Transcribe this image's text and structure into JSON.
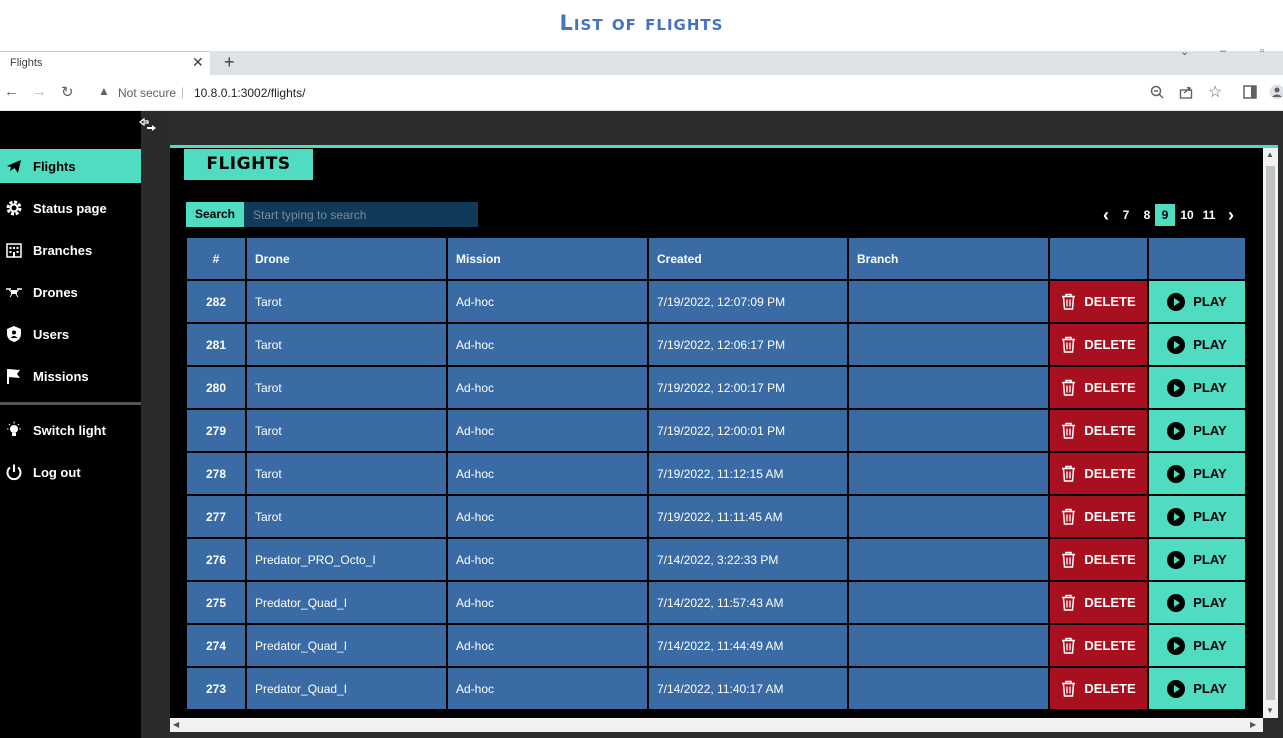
{
  "doc_title": "List of flights",
  "browser": {
    "tab_title": "Flights",
    "tab_close": "✕",
    "new_tab": "+",
    "back_icon": "←",
    "forward_icon": "→",
    "reload_icon": "↻",
    "not_secure": "Not secure",
    "url": "10.8.0.1:3002/flights/"
  },
  "sidebar": {
    "items": [
      {
        "label": "Flights",
        "icon": "plane-icon",
        "active": true
      },
      {
        "label": "Status page",
        "icon": "gear-icon"
      },
      {
        "label": "Branches",
        "icon": "building-icon"
      },
      {
        "label": "Drones",
        "icon": "drone-icon"
      },
      {
        "label": "Users",
        "icon": "shield-icon"
      },
      {
        "label": "Missions",
        "icon": "flag-icon"
      }
    ],
    "bottom_items": [
      {
        "label": "Switch light",
        "icon": "bulb-icon"
      },
      {
        "label": "Log out",
        "icon": "power-icon"
      }
    ]
  },
  "page": {
    "heading": "FLIGHTS",
    "search_label": "Search",
    "search_placeholder": "Start typing to search"
  },
  "pager": {
    "prev": "‹",
    "next": "›",
    "pages": [
      "7",
      "8",
      "9",
      "10",
      "11"
    ],
    "current": "9"
  },
  "table": {
    "headers": [
      "#",
      "Drone",
      "Mission",
      "Created",
      "Branch",
      "",
      ""
    ],
    "delete_label": "DELETE",
    "play_label": "PLAY",
    "rows": [
      {
        "id": "282",
        "drone": "Tarot",
        "mission": "Ad-hoc",
        "created": "7/19/2022, 12:07:09 PM",
        "branch": ""
      },
      {
        "id": "281",
        "drone": "Tarot",
        "mission": "Ad-hoc",
        "created": "7/19/2022, 12:06:17 PM",
        "branch": ""
      },
      {
        "id": "280",
        "drone": "Tarot",
        "mission": "Ad-hoc",
        "created": "7/19/2022, 12:00:17 PM",
        "branch": ""
      },
      {
        "id": "279",
        "drone": "Tarot",
        "mission": "Ad-hoc",
        "created": "7/19/2022, 12:00:01 PM",
        "branch": ""
      },
      {
        "id": "278",
        "drone": "Tarot",
        "mission": "Ad-hoc",
        "created": "7/19/2022, 11:12:15 AM",
        "branch": ""
      },
      {
        "id": "277",
        "drone": "Tarot",
        "mission": "Ad-hoc",
        "created": "7/19/2022, 11:11:45 AM",
        "branch": ""
      },
      {
        "id": "276",
        "drone": "Predator_PRO_Octo_I",
        "mission": "Ad-hoc",
        "created": "7/14/2022, 3:22:33 PM",
        "branch": ""
      },
      {
        "id": "275",
        "drone": "Predator_Quad_I",
        "mission": "Ad-hoc",
        "created": "7/14/2022, 11:57:43 AM",
        "branch": ""
      },
      {
        "id": "274",
        "drone": "Predator_Quad_I",
        "mission": "Ad-hoc",
        "created": "7/14/2022, 11:44:49 AM",
        "branch": ""
      },
      {
        "id": "273",
        "drone": "Predator_Quad_I",
        "mission": "Ad-hoc",
        "created": "7/14/2022, 11:40:17 AM",
        "branch": ""
      }
    ]
  },
  "colors": {
    "accent": "#4fdcc0",
    "table_cell": "#3a6ba5",
    "delete": "#a8101f",
    "title_blue": "#4472c4"
  }
}
